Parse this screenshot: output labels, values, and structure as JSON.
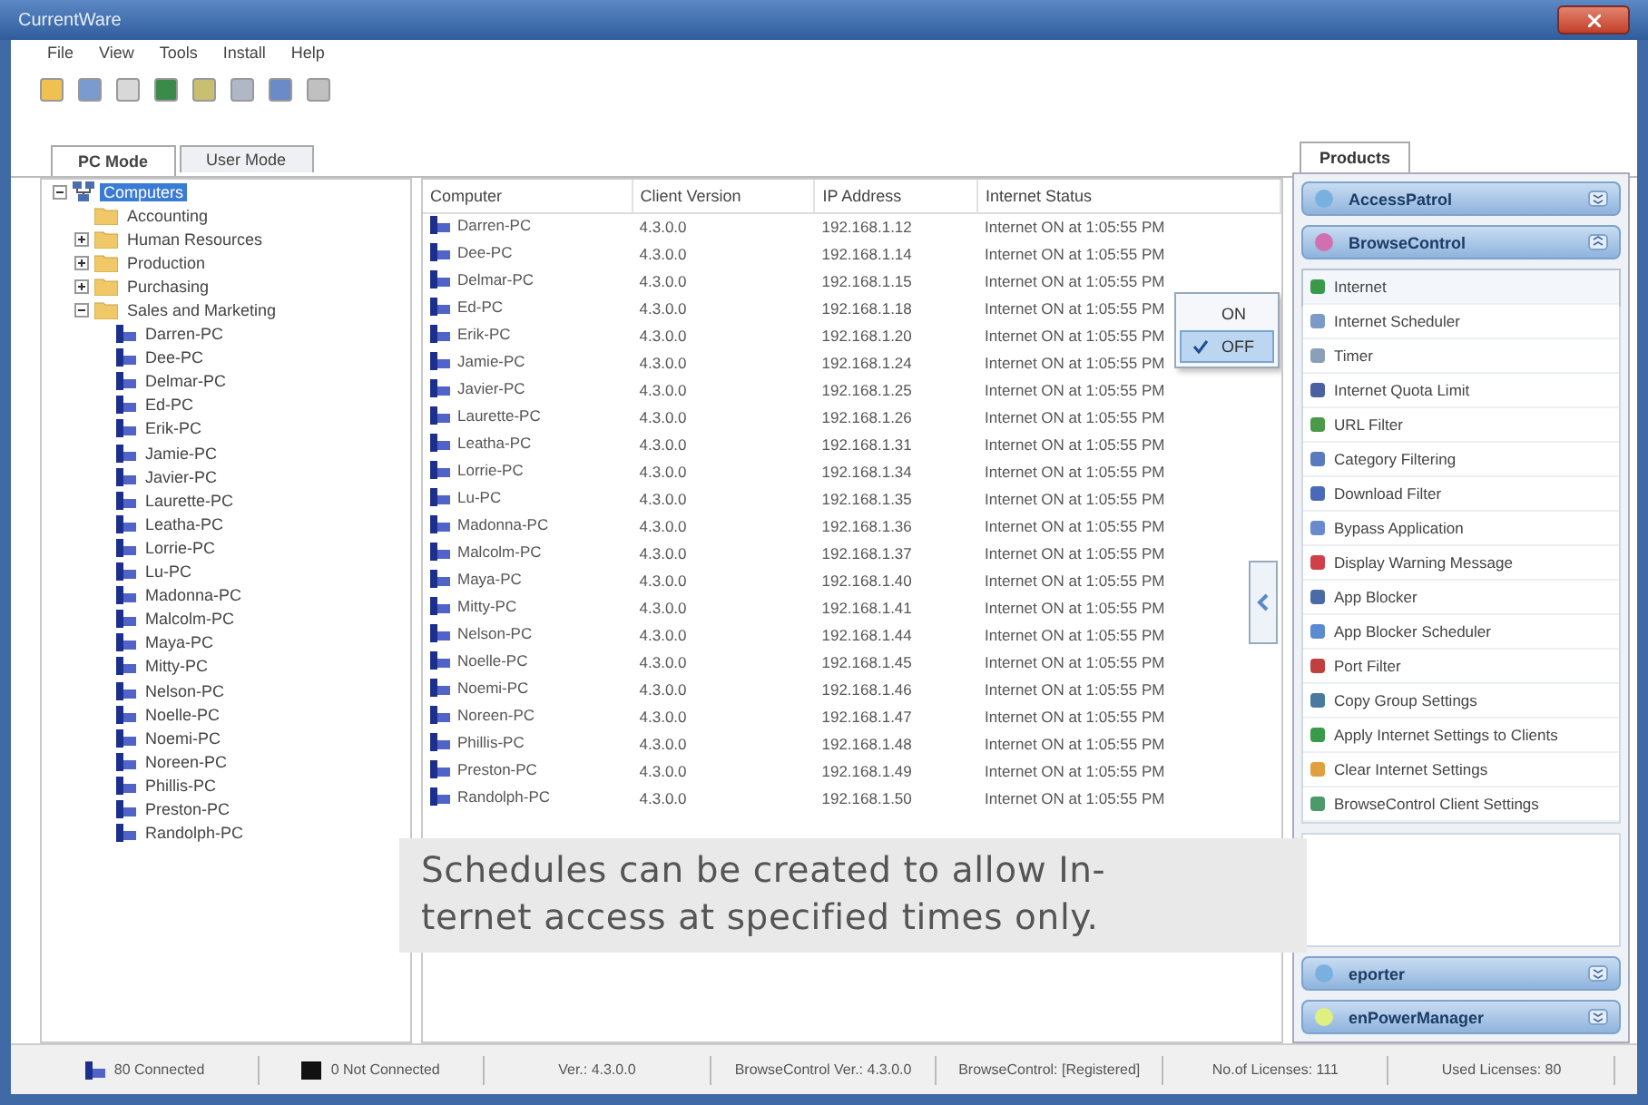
{
  "window": {
    "title": "CurrentWare"
  },
  "menu": [
    "File",
    "View",
    "Tools",
    "Install",
    "Help"
  ],
  "mode_tabs": [
    {
      "label": "PC Mode",
      "selected": true
    },
    {
      "label": "User Mode",
      "selected": false
    }
  ],
  "tree": {
    "label": "Computers",
    "selected": true,
    "expanded": true,
    "children": [
      {
        "label": "Accounting",
        "kind": "group"
      },
      {
        "label": "Human Resources",
        "kind": "group",
        "expanded": false
      },
      {
        "label": "Production",
        "kind": "group",
        "expanded": false
      },
      {
        "label": "Purchasing",
        "kind": "group",
        "expanded": false
      },
      {
        "label": "Sales and Marketing",
        "kind": "group",
        "expanded": true,
        "children": [
          {
            "label": "Darren-PC",
            "kind": "pc"
          },
          {
            "label": "Dee-PC",
            "kind": "pc"
          },
          {
            "label": "Delmar-PC",
            "kind": "pc"
          },
          {
            "label": "Ed-PC",
            "kind": "pc"
          },
          {
            "label": "Erik-PC",
            "kind": "pc"
          },
          {
            "label": "Jamie-PC",
            "kind": "pc"
          },
          {
            "label": "Javier-PC",
            "kind": "pc"
          },
          {
            "label": "Laurette-PC",
            "kind": "pc"
          },
          {
            "label": "Leatha-PC",
            "kind": "pc"
          },
          {
            "label": "Lorrie-PC",
            "kind": "pc"
          },
          {
            "label": "Lu-PC",
            "kind": "pc"
          },
          {
            "label": "Madonna-PC",
            "kind": "pc"
          },
          {
            "label": "Malcolm-PC",
            "kind": "pc"
          },
          {
            "label": "Maya-PC",
            "kind": "pc"
          },
          {
            "label": "Mitty-PC",
            "kind": "pc"
          },
          {
            "label": "Nelson-PC",
            "kind": "pc"
          },
          {
            "label": "Noelle-PC",
            "kind": "pc"
          },
          {
            "label": "Noemi-PC",
            "kind": "pc"
          },
          {
            "label": "Noreen-PC",
            "kind": "pc"
          },
          {
            "label": "Phillis-PC",
            "kind": "pc"
          },
          {
            "label": "Preston-PC",
            "kind": "pc"
          },
          {
            "label": "Randolph-PC",
            "kind": "pc"
          }
        ]
      }
    ]
  },
  "table": {
    "columns": [
      "Computer",
      "Client Version",
      "IP Address",
      "Internet Status"
    ],
    "rows": [
      {
        "computer": "Darren-PC",
        "version": "4.3.0.0",
        "ip": "192.168.1.12",
        "status": "Internet ON at 1:05:55 PM"
      },
      {
        "computer": "Dee-PC",
        "version": "4.3.0.0",
        "ip": "192.168.1.14",
        "status": "Internet ON at 1:05:55 PM"
      },
      {
        "computer": "Delmar-PC",
        "version": "4.3.0.0",
        "ip": "192.168.1.15",
        "status": "Internet ON at 1:05:55 PM"
      },
      {
        "computer": "Ed-PC",
        "version": "4.3.0.0",
        "ip": "192.168.1.18",
        "status": "Internet ON at 1:05:55 PM"
      },
      {
        "computer": "Erik-PC",
        "version": "4.3.0.0",
        "ip": "192.168.1.20",
        "status": "Internet ON at 1:05:55 PM"
      },
      {
        "computer": "Jamie-PC",
        "version": "4.3.0.0",
        "ip": "192.168.1.24",
        "status": "Internet ON at 1:05:55 PM"
      },
      {
        "computer": "Javier-PC",
        "version": "4.3.0.0",
        "ip": "192.168.1.25",
        "status": "Internet ON at 1:05:55 PM"
      },
      {
        "computer": "Laurette-PC",
        "version": "4.3.0.0",
        "ip": "192.168.1.26",
        "status": "Internet ON at 1:05:55 PM"
      },
      {
        "computer": "Leatha-PC",
        "version": "4.3.0.0",
        "ip": "192.168.1.31",
        "status": "Internet ON at 1:05:55 PM"
      },
      {
        "computer": "Lorrie-PC",
        "version": "4.3.0.0",
        "ip": "192.168.1.34",
        "status": "Internet ON at 1:05:55 PM"
      },
      {
        "computer": "Lu-PC",
        "version": "4.3.0.0",
        "ip": "192.168.1.35",
        "status": "Internet ON at 1:05:55 PM"
      },
      {
        "computer": "Madonna-PC",
        "version": "4.3.0.0",
        "ip": "192.168.1.36",
        "status": "Internet ON at 1:05:55 PM"
      },
      {
        "computer": "Malcolm-PC",
        "version": "4.3.0.0",
        "ip": "192.168.1.37",
        "status": "Internet ON at 1:05:55 PM"
      },
      {
        "computer": "Maya-PC",
        "version": "4.3.0.0",
        "ip": "192.168.1.40",
        "status": "Internet ON at 1:05:55 PM"
      },
      {
        "computer": "Mitty-PC",
        "version": "4.3.0.0",
        "ip": "192.168.1.41",
        "status": "Internet ON at 1:05:55 PM"
      },
      {
        "computer": "Nelson-PC",
        "version": "4.3.0.0",
        "ip": "192.168.1.44",
        "status": "Internet ON at 1:05:55 PM"
      },
      {
        "computer": "Noelle-PC",
        "version": "4.3.0.0",
        "ip": "192.168.1.45",
        "status": "Internet ON at 1:05:55 PM"
      },
      {
        "computer": "Noemi-PC",
        "version": "4.3.0.0",
        "ip": "192.168.1.46",
        "status": "Internet ON at 1:05:55 PM"
      },
      {
        "computer": "Noreen-PC",
        "version": "4.3.0.0",
        "ip": "192.168.1.47",
        "status": "Internet ON at 1:05:55 PM"
      },
      {
        "computer": "Phillis-PC",
        "version": "4.3.0.0",
        "ip": "192.168.1.48",
        "status": "Internet ON at 1:05:55 PM"
      },
      {
        "computer": "Preston-PC",
        "version": "4.3.0.0",
        "ip": "192.168.1.49",
        "status": "Internet ON at 1:05:55 PM"
      },
      {
        "computer": "Randolph-PC",
        "version": "4.3.0.0",
        "ip": "192.168.1.50",
        "status": "Internet ON at 1:05:55 PM"
      }
    ]
  },
  "context_menu": [
    {
      "label": "ON",
      "checked": false,
      "selected": false
    },
    {
      "label": "OFF",
      "checked": true,
      "selected": true
    }
  ],
  "products": {
    "tab": "Products",
    "sections": [
      {
        "title": "AccessPatrol",
        "expanded": false
      },
      {
        "title": "BrowseControl",
        "expanded": true,
        "items": [
          {
            "label": "Internet",
            "selected": true
          },
          {
            "label": "Internet Scheduler",
            "selected": false
          },
          {
            "label": "Timer",
            "selected": false
          },
          {
            "label": "Internet Quota Limit",
            "selected": false
          },
          {
            "label": "URL Filter",
            "selected": false
          },
          {
            "label": "Category Filtering",
            "selected": false
          },
          {
            "label": "Download Filter",
            "selected": false
          },
          {
            "label": "Bypass Application",
            "selected": false
          },
          {
            "label": "Display Warning Message",
            "selected": false
          },
          {
            "label": "App Blocker",
            "selected": false
          },
          {
            "label": "App Blocker Scheduler",
            "selected": false
          },
          {
            "label": "Port Filter",
            "selected": false
          },
          {
            "label": "Copy Group Settings",
            "selected": false
          },
          {
            "label": "Apply Internet Settings to Clients",
            "selected": false
          },
          {
            "label": "Clear Internet Settings",
            "selected": false
          },
          {
            "label": "BrowseControl Client Settings",
            "selected": false
          }
        ]
      },
      {
        "title": "eporter",
        "expanded": false
      },
      {
        "title": "enPowerManager",
        "expanded": false
      }
    ]
  },
  "status_bar": [
    {
      "text": "80 Connected",
      "kind": "connected"
    },
    {
      "text": "0 Not Connected",
      "kind": "disconnected"
    },
    {
      "text": "Ver.: 4.3.0.0",
      "kind": "plain"
    },
    {
      "text": "BrowseControl Ver.: 4.3.0.0",
      "kind": "plain"
    },
    {
      "text": "BrowseControl: [Registered]",
      "kind": "plain"
    },
    {
      "text": "No.of Licenses: 111",
      "kind": "plain"
    },
    {
      "text": "Used Licenses: 80",
      "kind": "plain"
    }
  ],
  "caption": {
    "lines": [
      "Schedules can be created to allow In-",
      "ternet access at specified times only."
    ]
  }
}
